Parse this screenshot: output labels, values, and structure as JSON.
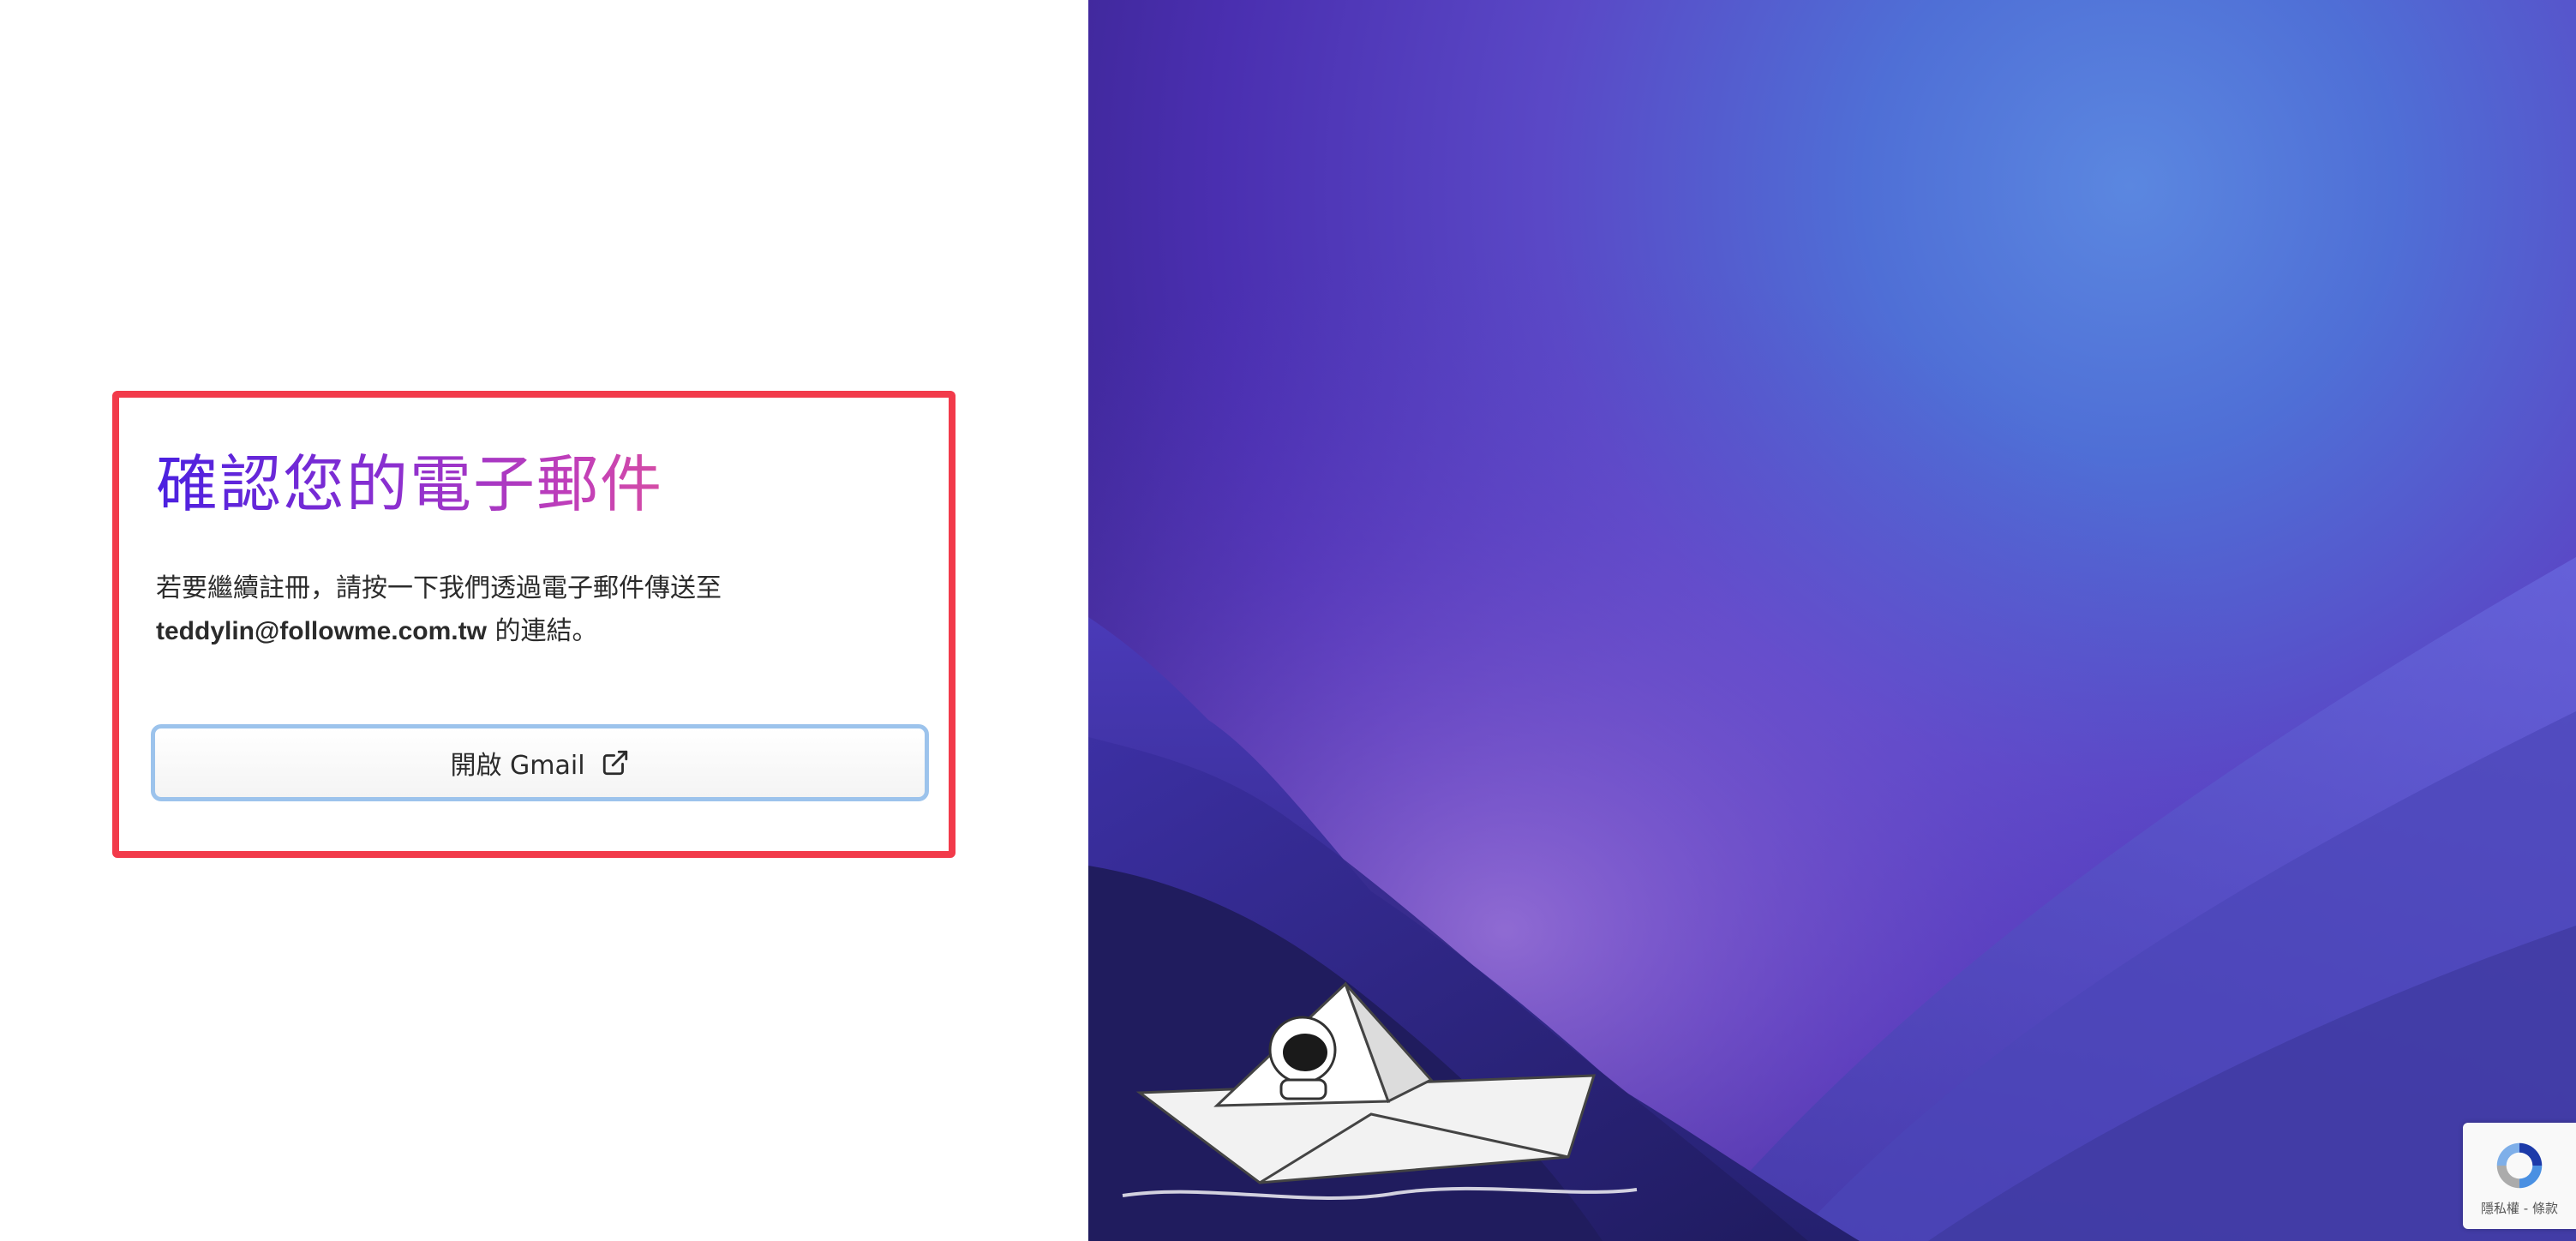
{
  "confirm": {
    "title": "確認您的電子郵件",
    "desc_line1": "若要繼續註冊，請按一下我們透過電子郵件傳送至",
    "email": "teddylin@followme.com.tw",
    "desc_suffix": " 的連結。",
    "button_label": "開啟 Gmail"
  },
  "recaptcha": {
    "links": "隱私權 - 條款"
  },
  "colors": {
    "highlight": "#f23a4a",
    "title_gradient_start": "#4a20e0",
    "title_gradient_end": "#f7637b",
    "button_border": "#9cc3ec"
  },
  "icons": {
    "button_icon": "external-link-icon",
    "recaptcha_icon": "recaptcha-icon"
  }
}
